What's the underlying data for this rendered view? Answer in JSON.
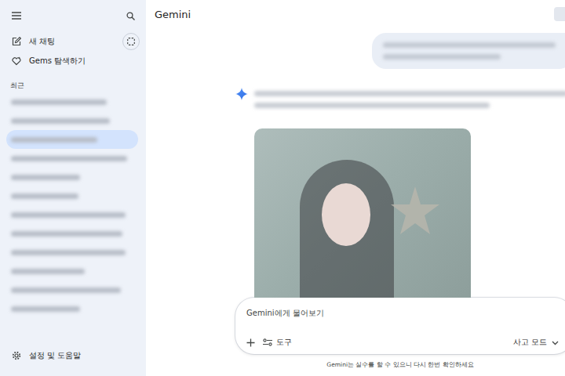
{
  "sidebar": {
    "new_chat": "새 채팅",
    "explore_gems": "Gems 탐색하기",
    "recent_heading": "최근",
    "recent": [
      {
        "selected": false
      },
      {
        "selected": false
      },
      {
        "selected": true
      },
      {
        "selected": false
      },
      {
        "selected": false
      },
      {
        "selected": false
      },
      {
        "selected": false
      },
      {
        "selected": false
      },
      {
        "selected": false
      },
      {
        "selected": false
      },
      {
        "selected": false
      },
      {
        "selected": false
      }
    ],
    "settings": "설정 및 도움말"
  },
  "header": {
    "title": "Gemini"
  },
  "composer": {
    "placeholder": "Gemini에게 물어보기",
    "tools": "도구",
    "mode": "사고 모드"
  },
  "disclaimer": "Gemini는 실수를 할 수 있으니 다시 한번 확인하세요"
}
